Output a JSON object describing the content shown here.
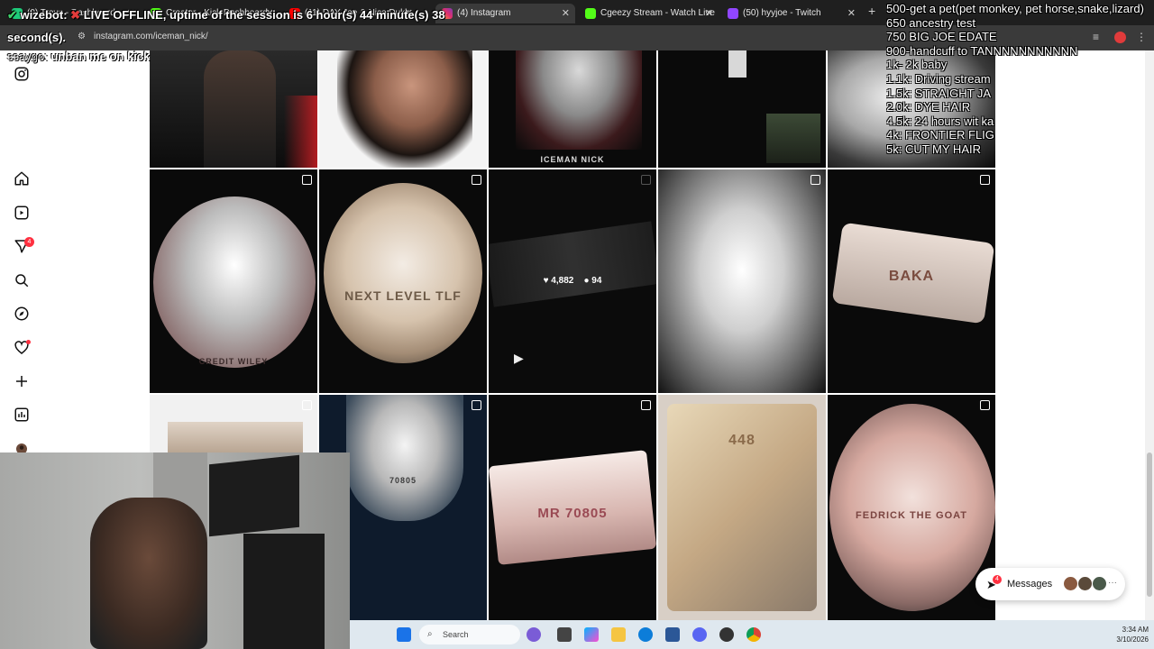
{
  "browser": {
    "tabs": [
      {
        "label": "(9) Trovo - Dashboard"
      },
      {
        "label": "Creator - Kick Dashboard"
      },
      {
        "label": "(11) DAY Joe & Nico Dukk..."
      },
      {
        "label": "(4) Instagram"
      },
      {
        "label": "Cgeezy Stream - Watch Live"
      },
      {
        "label": "(50) hyyjoe - Twitch"
      }
    ],
    "url": "instagram.com/iceman_nick/"
  },
  "overlay": {
    "bot_label": "wizebot:",
    "status_line": "LIVE OFFLINE, uptime of the session is 6 hour(s) 44 minute(s) 38",
    "status_line2": "second(s).",
    "chat_user": "ssaygo:",
    "chat_message": "unban me on kick"
  },
  "goals": [
    "500-get a pet(pet monkey, pet horse,snake,lizard)",
    "650 ancestry test",
    "750 BIG JOE EDATE",
    "900-handcuff to TANNNNNNNNNNN",
    "1k- 2k baby",
    "1.1k: Driving stream",
    "1.5k: STRAIGHT JA",
    "2.0k: DYE HAIR",
    "4.5k: 24 hours wit ka",
    "4k: FRONTIER FLIG",
    "5k: CUT MY HAIR"
  ],
  "instagram": {
    "notification_count": "4",
    "posts": [
      {
        "caption": "",
        "reel": false
      },
      {
        "caption": "",
        "reel": false
      },
      {
        "caption": "ICEMAN NICK",
        "reel": false
      },
      {
        "caption": "",
        "reel": false
      },
      {
        "caption": "",
        "reel": false
      },
      {
        "caption": "CREDIT WILEY",
        "reel": true
      },
      {
        "caption": "NEXT LEVEL TLF",
        "reel": true
      },
      {
        "caption": "",
        "reel": true,
        "likes": "4,882",
        "comments": "94"
      },
      {
        "caption": "",
        "reel": true
      },
      {
        "caption": "BAKA",
        "reel": true
      },
      {
        "caption": "",
        "reel": true
      },
      {
        "caption": "70805",
        "reel": true
      },
      {
        "caption": "MR 70805",
        "reel": true
      },
      {
        "caption": "448",
        "reel": false
      },
      {
        "caption": "FEDRICK THE GOAT",
        "reel": true
      }
    ],
    "messages_label": "Messages",
    "messages_count": "4"
  },
  "taskbar": {
    "search_placeholder": "Search",
    "time": "3:34 AM",
    "date": "3/10/2026"
  },
  "colors": {
    "accent": "#ff3040",
    "chrome_dark": "#1f1f1f"
  }
}
